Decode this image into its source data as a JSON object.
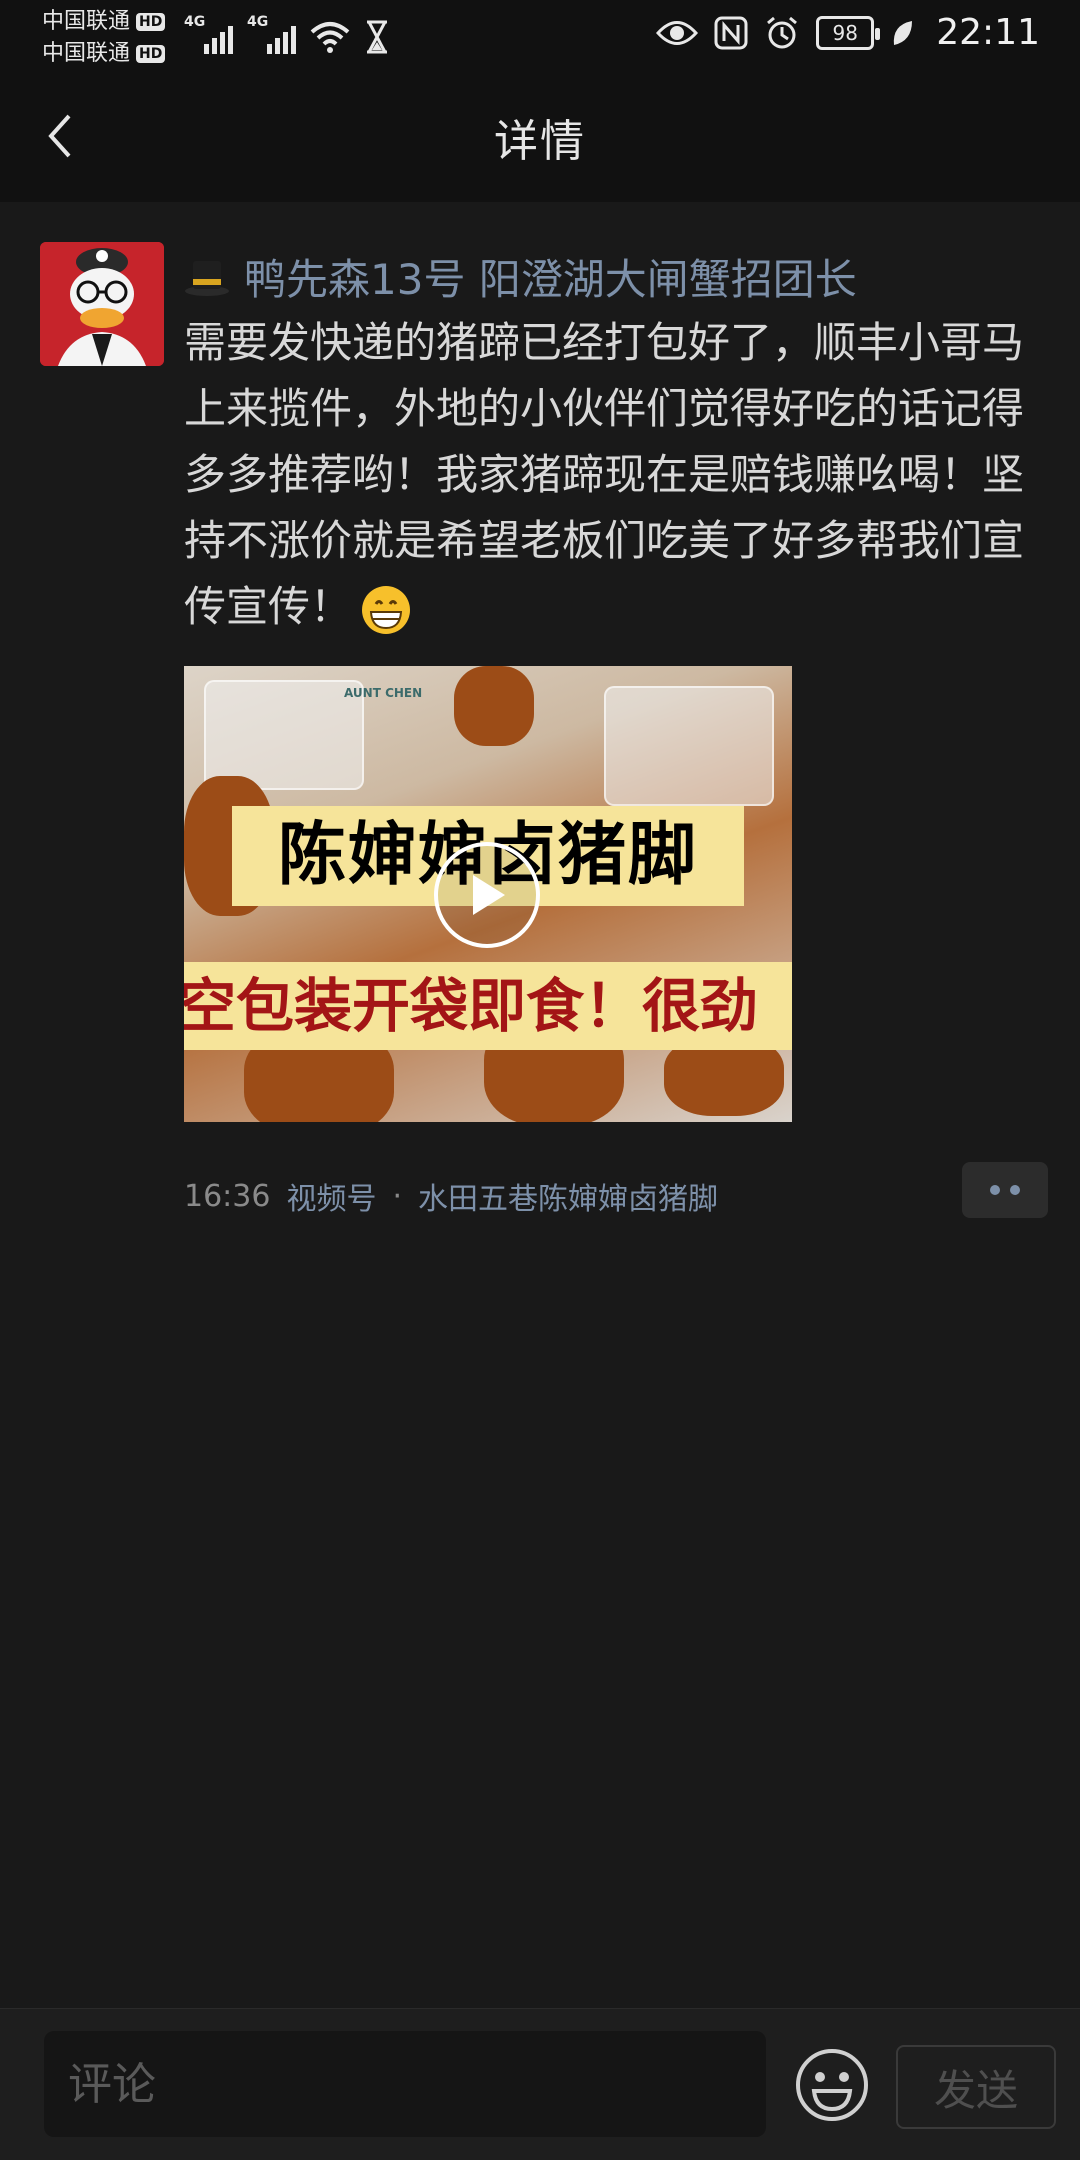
{
  "status_bar": {
    "carrier_1": "中国联通",
    "carrier_2": "中国联通",
    "hd_label": "HD",
    "network_type": "4G",
    "battery": "98",
    "time": "22:11",
    "icons": [
      "signal-icon",
      "wifi-icon",
      "hourglass-icon",
      "eye-icon",
      "nfc-icon",
      "alarm-icon",
      "battery-icon",
      "leaf-icon"
    ]
  },
  "nav": {
    "title": "详情",
    "back_icon": "chevron-left-icon"
  },
  "post": {
    "author_emoji": "top-hat-icon",
    "author_name": "鸭先森13号 阳澄湖大闸蟹招团长",
    "text": "需要发快递的猪蹄已经打包好了，顺丰小哥马上来揽件，外地的小伙伴们觉得好吃的话记得多多推荐哟！我家猪蹄现在是赔钱赚吆喝！坚持不涨价就是希望老板们吃美了好多帮我们宣传宣传！",
    "trailing_emoji": "grinning-face-icon",
    "video": {
      "title": "陈婶婶卤猪脚",
      "subtitle": "空包装开袋即食！很劲",
      "pack_label": "AUNT CHEN",
      "play_icon": "play-icon"
    },
    "meta": {
      "time": "16:36",
      "source": "视频号",
      "separator": "·",
      "channel": "水田五巷陈婶婶卤猪脚"
    },
    "more_icon": "more-dots-icon"
  },
  "comment_bar": {
    "placeholder": "评论",
    "emoji_icon": "smiley-icon",
    "send_label": "发送"
  },
  "colors": {
    "background": "#191919",
    "header": "#111111",
    "link": "#7d90a9",
    "text": "#d8d8d8",
    "avatar_bg": "#c6242b"
  }
}
